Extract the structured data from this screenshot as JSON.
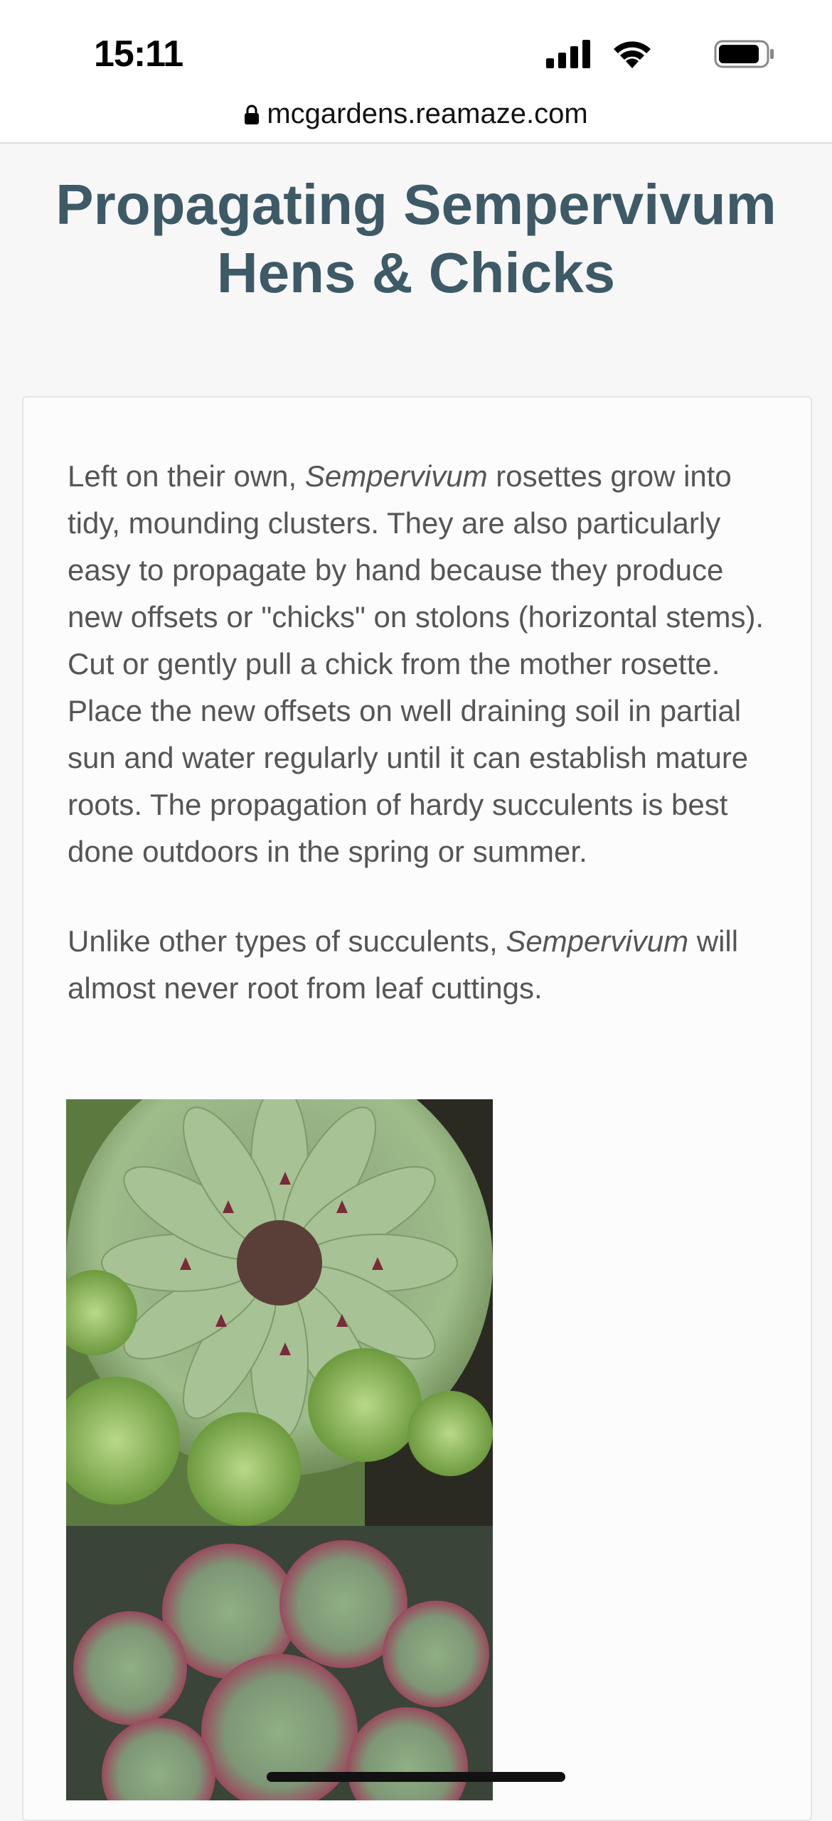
{
  "status_bar": {
    "time": "15:11",
    "icons": [
      "signal-icon",
      "wifi-icon",
      "battery-icon"
    ]
  },
  "browser": {
    "url": "mcgardens.reamaze.com",
    "lock_icon": "lock-icon"
  },
  "article": {
    "title": "Propagating Sempervivum Hens & Chicks",
    "p1_before_italic": "Left on their own, ",
    "p1_italic": "Sempervivum",
    "p1_after_italic": " rosettes grow into tidy, mounding clusters. They are also particularly easy to propagate by hand because they produce new offsets or \"chicks\" on stolons (horizontal stems).  Cut or gently pull a chick from the mother rosette. Place the new offsets on well draining soil in partial sun and water regularly until it can establish mature roots. The propagation of hardy succulents is best done outdoors in the spring or summer.",
    "p2_before_italic": "Unlike other types of succulents, ",
    "p2_italic": "Sempervivum",
    "p2_after_italic": " will almost never root from leaf cuttings.",
    "images": [
      "green sempervivum rosette photo",
      "red-tipped sempervivum cluster photo"
    ]
  },
  "colors": {
    "title": "#3d5a66",
    "body_text": "#555555",
    "page_bg": "#f7f7f7",
    "card_bg": "#fcfcfc"
  }
}
